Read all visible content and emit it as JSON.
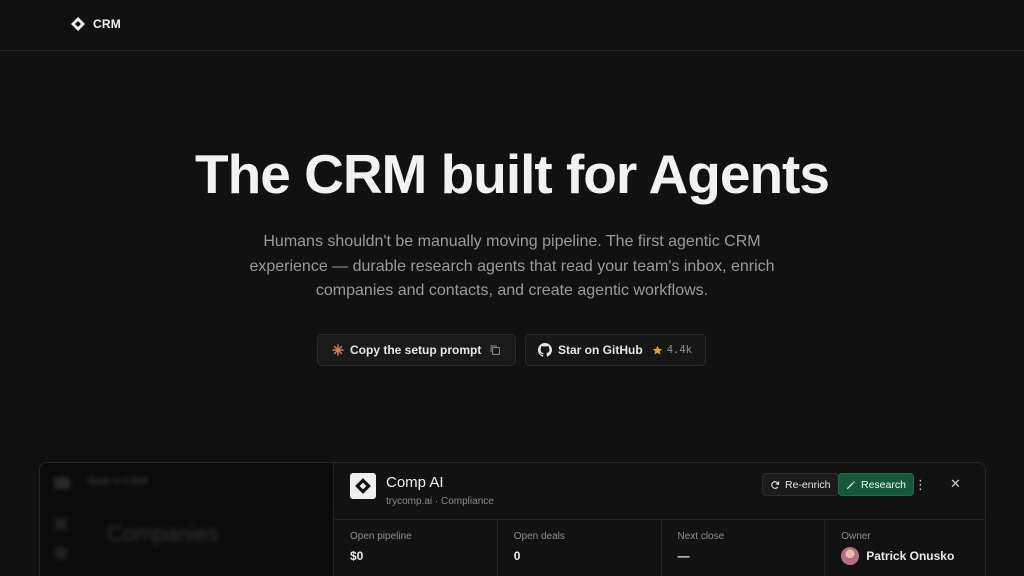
{
  "nav": {
    "brand": "CRM"
  },
  "hero": {
    "title": "The CRM built for Agents",
    "subtitle": "Humans shouldn't be manually moving pipeline. The first agentic CRM experience — durable research agents that read your team's inbox, enrich companies and contacts, and create agentic workflows."
  },
  "cta": {
    "copy_label": "Copy the setup prompt",
    "github_label": "Star on GitHub",
    "star_count": "4.4k"
  },
  "preview": {
    "back_label": "Back to CRM",
    "section_title": "Companies",
    "company": {
      "name": "Comp AI",
      "meta": "trycomp.ai · Compliance"
    },
    "actions": {
      "reenrich": "Re-enrich",
      "research": "Research"
    },
    "stats": [
      {
        "label": "Open pipeline",
        "value": "$0"
      },
      {
        "label": "Open deals",
        "value": "0"
      },
      {
        "label": "Next close",
        "value": "—"
      }
    ],
    "owner": {
      "label": "Owner",
      "name": "Patrick Onusko"
    }
  },
  "colors": {
    "background": "#111111",
    "research_button": "#17573a",
    "star": "#e0a526",
    "sparkle": "#e07a4f"
  }
}
